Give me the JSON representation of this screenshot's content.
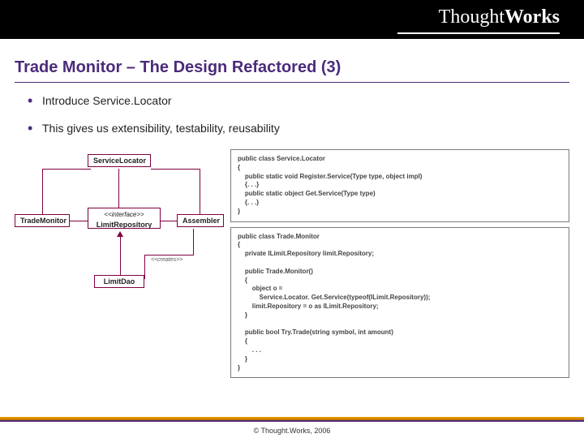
{
  "brand": {
    "thin": "Thought",
    "bold": "Works"
  },
  "title": "Trade Monitor – The Design Refactored (3)",
  "bullets": [
    "Introduce Service.Locator",
    "This gives us extensibility, testability, reusability"
  ],
  "uml": {
    "serviceLocator": "ServiceLocator",
    "tradeMonitor": "TradeMonitor",
    "repoStereo": "<<interface>>",
    "repoName": "LimitRepository",
    "assembler": "Assembler",
    "limitDao": "LimitDao",
    "createsLabel": "<<creates>>"
  },
  "code": {
    "block1": "public class Service.Locator\n{\n    public static void Register.Service(Type type, object impl)\n    {. . .}\n    public static object Get.Service(Type type)\n    {. . .}\n}",
    "block2": "public class Trade.Monitor\n{\n    private ILimit.Repository limit.Repository;\n\n    public Trade.Monitor()\n    {\n        object o =\n            Service.Locator. Get.Service(typeof(ILimit.Repository));\n        limit.Repository = o as ILimit.Repository;\n    }\n\n    public bool Try.Trade(string symbol, int amount)\n    {\n        . . .\n    }\n}"
  },
  "copyright": "© Thought.Works, 2006"
}
